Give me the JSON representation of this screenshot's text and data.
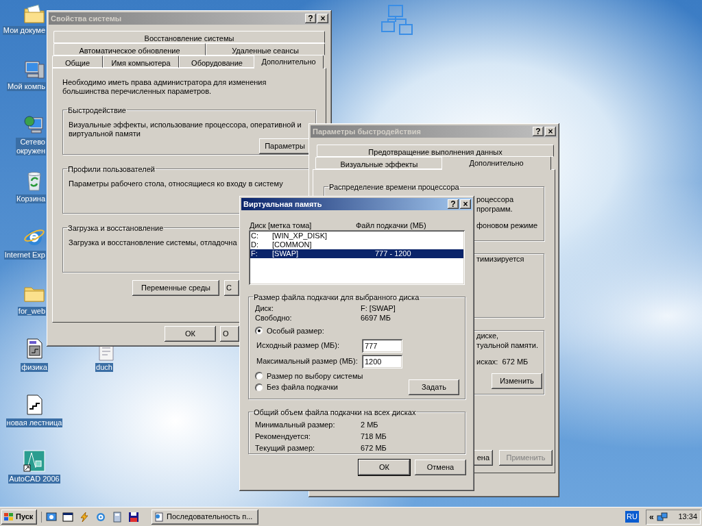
{
  "desktop_icons": [
    {
      "kind": "folder-docs",
      "lines": [
        "Мои докуме"
      ]
    },
    {
      "kind": "computer",
      "lines": [
        "Мой компь"
      ]
    },
    {
      "kind": "network",
      "lines": [
        "Сетево",
        "окружен"
      ]
    },
    {
      "kind": "recycle",
      "lines": [
        "Корзина"
      ]
    },
    {
      "kind": "browser",
      "lines": [
        "Internet Exp"
      ]
    },
    {
      "kind": "folder",
      "lines": [
        "for_web"
      ]
    },
    {
      "kind": "cad-doc",
      "lines": [
        "физика"
      ]
    },
    {
      "kind": "stairs-doc",
      "lines": [
        "новая лестница"
      ]
    },
    {
      "kind": "autocad",
      "lines": [
        "AutoCAD 2006"
      ]
    },
    {
      "kind": "note",
      "lines": [
        "duch"
      ]
    },
    {
      "kind": "network-tile"
    }
  ],
  "system_properties": {
    "title": "Свойства системы",
    "active": false,
    "title_buttons": [
      "?",
      "×"
    ],
    "tab_rows": [
      [
        {
          "label": "Восстановление системы",
          "selected": false
        }
      ],
      [
        {
          "label": "Автоматическое обновление",
          "selected": false
        },
        {
          "label": "Удаленные сеансы",
          "selected": false
        }
      ],
      [
        {
          "label": "Общие",
          "selected": false
        },
        {
          "label": "Имя компьютера",
          "selected": false
        },
        {
          "label": "Оборудование",
          "selected": false
        },
        {
          "label": "Дополнительно",
          "selected": true
        }
      ]
    ],
    "note": "Необходимо иметь права администратора для изменения большинства перечисленных параметров.",
    "groups": [
      {
        "title": "Быстродействие",
        "text": "Визуальные эффекты, использование процессора, оперативной и виртуальной памяти",
        "button": "Параметры"
      },
      {
        "title": "Профили пользователей",
        "text": "Параметры рабочего стола, относящиеся ко входу в систему"
      },
      {
        "title": "Загрузка и восстановление",
        "text": "Загрузка и восстановление системы, отладочна"
      }
    ],
    "panel_buttons": [
      "Переменные среды",
      "С"
    ],
    "dialog_buttons": [
      "ОК",
      "О"
    ]
  },
  "performance_options": {
    "title": "Параметры быстродействия",
    "active": false,
    "title_buttons": [
      "?",
      "×"
    ],
    "tab_rows": [
      [
        {
          "label": "Предотвращение выполнения данных",
          "selected": false
        }
      ],
      [
        {
          "label": "Визуальные эффекты",
          "selected": false
        },
        {
          "label": "Дополнительно",
          "selected": true
        }
      ]
    ],
    "groups": [
      {
        "title": "Распределение времени процессора",
        "paragraphs": [
          {
            "lines": [
              "роцессора",
              "программ."
            ]
          },
          {
            "lines": [
              "фоновом режиме"
            ]
          }
        ]
      },
      {
        "paragraphs": [
          {
            "lines": [
              "тимизируется"
            ]
          }
        ]
      },
      {
        "paragraphs": [
          {
            "lines": [
              "диске,",
              "туальной памяти."
            ]
          },
          {
            "lines": [
              "исках:  672 МБ"
            ]
          }
        ],
        "button": "Изменить"
      }
    ],
    "dialog_buttons": [
      {
        "label": "ена",
        "disabled": false
      },
      {
        "label": "Применить",
        "disabled": true
      }
    ]
  },
  "virtual_memory": {
    "title": "Виртуальная память",
    "active": true,
    "title_buttons": [
      "?",
      "×"
    ],
    "columns": [
      "Диск [метка тома]",
      "Файл подкачки (МБ)"
    ],
    "drives": [
      {
        "letter": "C:",
        "label": "[WIN_XP_DISK]",
        "selected": false
      },
      {
        "letter": "D:",
        "label": "[COMMON]",
        "selected": false
      },
      {
        "letter": "F:",
        "label": "[SWAP]",
        "size": "777 - 1200",
        "selected": true
      }
    ],
    "selected_drive": {
      "title": "Размер файла подкачки для выбранного диска",
      "info": [
        {
          "label": "Диск:",
          "value": "F:  [SWAP]"
        },
        {
          "label": "Свободно:",
          "value": "6697 МБ"
        }
      ],
      "custom": {
        "label": "Особый размер:",
        "selected": true
      },
      "fields": [
        {
          "label": "Исходный размер (МБ):",
          "value": "777"
        },
        {
          "label": "Максимальный размер (МБ):",
          "value": "1200"
        }
      ],
      "options": [
        {
          "label": "Размер по выбору системы",
          "selected": false
        },
        {
          "label": "Без файла подкачки",
          "selected": false
        }
      ],
      "button": "Задать"
    },
    "totals": {
      "title": "Общий объем файла подкачки на всех дисках",
      "rows": [
        {
          "label": "Минимальный размер:",
          "value": "2 МБ"
        },
        {
          "label": "Рекомендуется:",
          "value": "718 МБ"
        },
        {
          "label": "Текущий размер:",
          "value": "672 МБ"
        }
      ]
    },
    "dialog_buttons": [
      "ОК",
      "Отмена"
    ]
  },
  "taskbar": {
    "start": "Пуск",
    "quick_launch": [
      {
        "kind": "desktop"
      },
      {
        "kind": "window"
      },
      {
        "kind": "lightning"
      },
      {
        "kind": "browser"
      },
      {
        "kind": "calculator"
      },
      {
        "kind": "floppy"
      }
    ],
    "tasks": [
      {
        "label": "Последовательность п...",
        "selected": false
      }
    ],
    "language": "RU",
    "tray_toggle": "«",
    "clock": "13:34"
  }
}
